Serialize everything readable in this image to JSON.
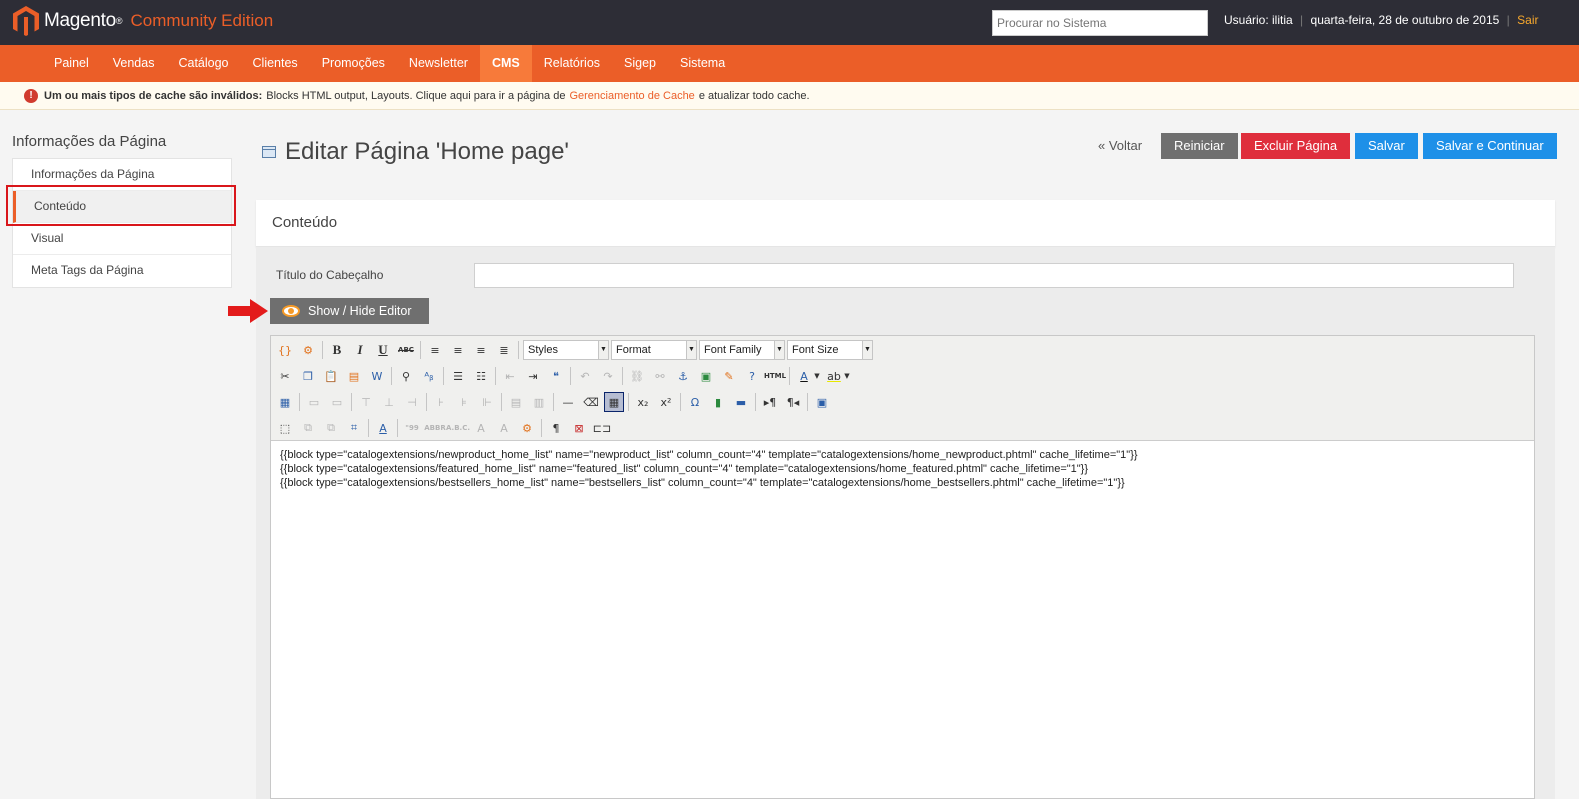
{
  "header": {
    "brand": "Magento",
    "edition": "Community Edition",
    "search_placeholder": "Procurar no Sistema",
    "user": "Usuário: ilitia",
    "date": "quarta-feira, 28 de outubro de 2015",
    "logout": "Sair"
  },
  "nav": [
    "Painel",
    "Vendas",
    "Catálogo",
    "Clientes",
    "Promoções",
    "Newsletter",
    "CMS",
    "Relatórios",
    "Sigep",
    "Sistema"
  ],
  "notice": {
    "bold": "Um ou mais tipos de cache são inválidos:",
    "text": "Blocks HTML output, Layouts. Clique aqui para ir a página de",
    "link": "Gerenciamento de Cache",
    "tail": "e atualizar todo cache."
  },
  "sidebar": {
    "title": "Informações da Página",
    "tabs": [
      "Informações da Página",
      "Conteúdo",
      "Visual",
      "Meta Tags da Página"
    ]
  },
  "page": {
    "title": "Editar Página 'Home page'",
    "back": "« Voltar",
    "reset": "Reiniciar",
    "delete": "Excluir Página",
    "save": "Salvar",
    "save_continue": "Salvar e Continuar"
  },
  "section": {
    "title": "Conteúdo",
    "field_label": "Título do Cabeçalho",
    "field_value": "",
    "editor_toggle": "Show / Hide Editor"
  },
  "editor": {
    "styles": "Styles",
    "format": "Format",
    "font_family": "Font Family",
    "font_size": "Font Size",
    "content": [
      "{{block type=\"catalogextensions/newproduct_home_list\" name=\"newproduct_list\" column_count=\"4\" template=\"catalogextensions/home_newproduct.phtml\" cache_lifetime=\"1\"}}",
      "{{block type=\"catalogextensions/featured_home_list\" name=\"featured_list\" column_count=\"4\" template=\"catalogextensions/home_featured.phtml\" cache_lifetime=\"1\"}}",
      "{{block type=\"catalogextensions/bestsellers_home_list\" name=\"bestsellers_list\" column_count=\"4\" template=\"catalogextensions/home_bestsellers.phtml\" cache_lifetime=\"1\"}}"
    ]
  },
  "colors": {
    "header_bg": "#2d2d36",
    "nav_bg": "#eb5e28",
    "accent": "#eb5e28",
    "primary_button": "#1e90e8",
    "delete_button": "#df2e3c",
    "highlight": "#d9161b"
  }
}
